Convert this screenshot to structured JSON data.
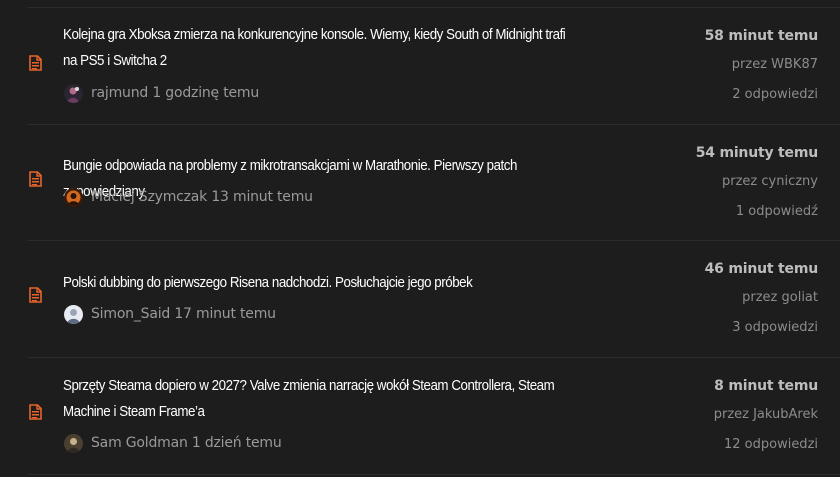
{
  "colors": {
    "background": "#1d1d1d",
    "divider": "#2b2b2b",
    "accent_icon": "#e8642a",
    "title_text": "#ffffff",
    "muted_text": "#9a9a9a"
  },
  "topics": [
    {
      "icon": "document-icon",
      "title": "Kolejna gra Xboksa zmierza na konkurencyjne konsole. Wiemy, kiedy South of Midnight trafi na PS5 i Switcha 2",
      "author_line": "rajmund 1 godzinę temu",
      "last_post_time": "58 minut temu",
      "last_post_by": "przez WBK87",
      "replies": "2 odpowiedzi"
    },
    {
      "icon": "document-icon",
      "title": "Bungie odpowiada na problemy z mikrotransakcjami w Marathonie. Pierwszy patch zapowiedziany",
      "author_line": "Maciej Szymczak 13 minut temu",
      "last_post_time": "54 minuty temu",
      "last_post_by": "przez cyniczny",
      "replies": "1 odpowiedź"
    },
    {
      "icon": "document-icon",
      "title": "Polski dubbing do pierwszego Risena nadchodzi. Posłuchajcie jego próbek",
      "author_line": "Simon_Said 17 minut temu",
      "last_post_time": "46 minut temu",
      "last_post_by": "przez goliat",
      "replies": "3 odpowiedzi"
    },
    {
      "icon": "document-icon",
      "title": "Sprzęty Steama dopiero w 2027? Valve zmienia narrację wokół Steam Controllera, Steam Machine i Steam Frame’a",
      "author_line": "Sam Goldman 1 dzień temu",
      "last_post_time": "8 minut temu",
      "last_post_by": "przez JakubArek",
      "replies": "12 odpowiedzi"
    }
  ]
}
